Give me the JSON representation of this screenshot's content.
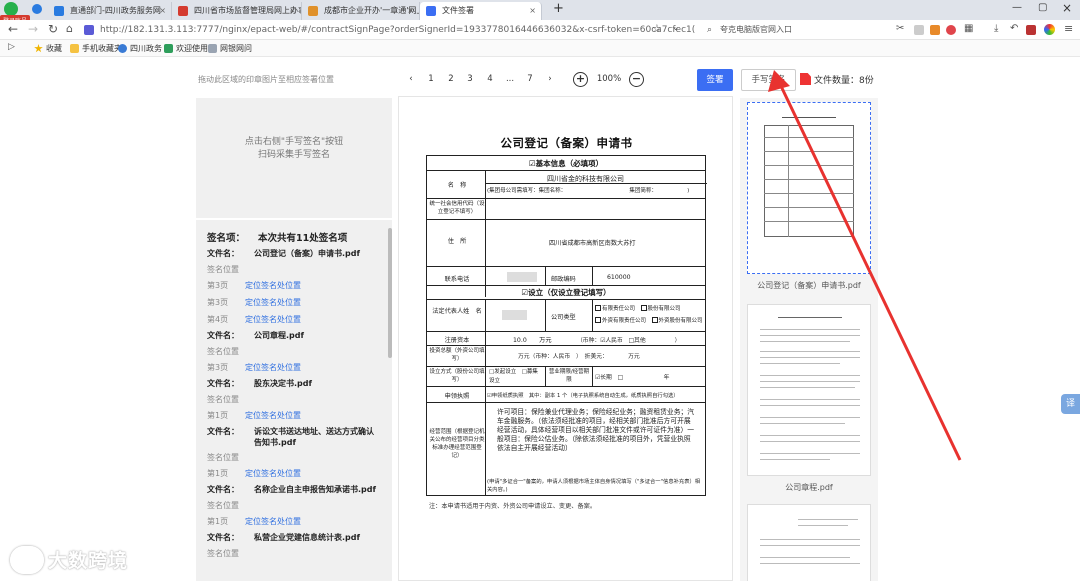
{
  "browser": {
    "tabs": [
      {
        "title": "直通部门-四川政务服务网",
        "color": "#2a7be0"
      },
      {
        "title": "四川省市场监督管理局网上办事",
        "color": "#d43b2f"
      },
      {
        "title": "成都市企业开办'一章通'网上",
        "color": "#e0912a"
      },
      {
        "title": "文件签署",
        "color": "#3b6ef3"
      }
    ],
    "url": "http://182.131.3.113:7777/nginx/epact-web/#/contractSignPage?orderSignerId=1933778016446636032&x-csrf-token=60ca7cfec1(",
    "search_text": "夸克电脑版官网入口",
    "bookmarks": [
      "收藏",
      "手机收藏夹",
      "四川政务",
      "欢迎使用",
      "网银网问"
    ],
    "corner_badge": "登录账号"
  },
  "toolbar": {
    "hint": "拖动此区域的印章图片至相应签署位置",
    "pages": [
      "1",
      "2",
      "3",
      "4",
      "...",
      "7"
    ],
    "zoom": "100%",
    "zoom_in": "+",
    "zoom_out": "−",
    "sign_label": "签署",
    "handwrite_label": "手写签名",
    "file_count": "文件数量：8份"
  },
  "stamp_area": {
    "line1": "点击右侧\"手写签名\"按钮",
    "line2": "扫码采集手写签名"
  },
  "sign_list": {
    "header_label": "签名项：",
    "header_summary": "本次共有11处签名项",
    "file_label": "文件名：",
    "pos_label": "签名位置",
    "locate_label": "定位签名处位置",
    "files": [
      {
        "name": "公司登记（备案）申请书.pdf",
        "pages": [
          "第3页",
          "第3页",
          "第4页"
        ]
      },
      {
        "name": "公司章程.pdf",
        "pages": [
          "第3页"
        ]
      },
      {
        "name": "股东决定书.pdf",
        "pages": [
          "第1页"
        ]
      },
      {
        "name": "诉讼文书送达地址、送达方式确认告知书.pdf",
        "pages": [
          "第1页"
        ]
      },
      {
        "name": "名称企业自主申报告知承诺书.pdf",
        "pages": [
          "第1页"
        ]
      },
      {
        "name": "私营企业党建信息统计表.pdf",
        "pages": []
      }
    ]
  },
  "document": {
    "title": "公司登记（备案）申请书",
    "sec1": "☑基本信息（必填项）",
    "name_label": "名　称",
    "company": "四川省金的科技有限公司",
    "parent_line": "(集团母公司需填写：集团名称：　　　　　　　　　　　　集团简称：　　　　　　)",
    "credit_label": "统一社会信用代码（设立登记不填写）",
    "addr_label": "住　所",
    "address": "四川省成都市高新区南数大苏打",
    "phone_label": "联系电话",
    "zip_label": "邮政编码",
    "zip": "610000",
    "sec2": "☑设立（仅设立登记填写）",
    "legal_label": "法定代表人姓　名",
    "type_label": "公司类型",
    "type_opts": [
      "有限责任公司",
      "股份有限公司",
      "外资有限责任公司",
      "外资股份有限公司"
    ],
    "cap_label": "注册资本",
    "cap_value": "10.0　　万元",
    "cur_label": "（币种：☑人民币　□其他　　　　　）",
    "invest_label": "投资总额（外资公司填写）",
    "invest_value": "　　　　　万元（币种：人民币　）　折美元：　　　　万元",
    "method_label": "设立方式（股份公司填写）",
    "method_opts": "□发起设立　□募集设立",
    "term_label": "营业期限/经营期限",
    "term_value": "☑长期　□　　　　　　　年",
    "copy_label": "申领执照",
    "copy_value": "☑申领纸质执照　其中：副本 1 个（电子执照系统自动生成，纸质执照自行勾选）",
    "scope_label": "经营范围（根据登记机关公布的经营项目分类标准办理经营范围登记）",
    "scope_text": "许可项目：保险兼业代理业务；保险经纪业务；融资租赁业务；汽车金融服务。（依法须经批准的项目，经相关部门批准后方可开展经营活动，具体经营项目以相关部门批准文件或许可证件为准）一般项目：保险公估业务。（除依法须经批准的项目外，凭营业执照依法自主开展经营活动）",
    "scope_foot": "(申请\"多证合一\"备案的，申请人须根据市场主体自身情况填写（\"多证合一\"信息补充表）相关内容。)",
    "note": "注：本申请书适用于内资、外资公司申请设立、变更、备案。"
  },
  "thumbnails": [
    {
      "label": "公司登记（备案）申请书.pdf"
    },
    {
      "label": "公司章程.pdf"
    }
  ],
  "side_tab": "译",
  "watermark": "大数跨境"
}
